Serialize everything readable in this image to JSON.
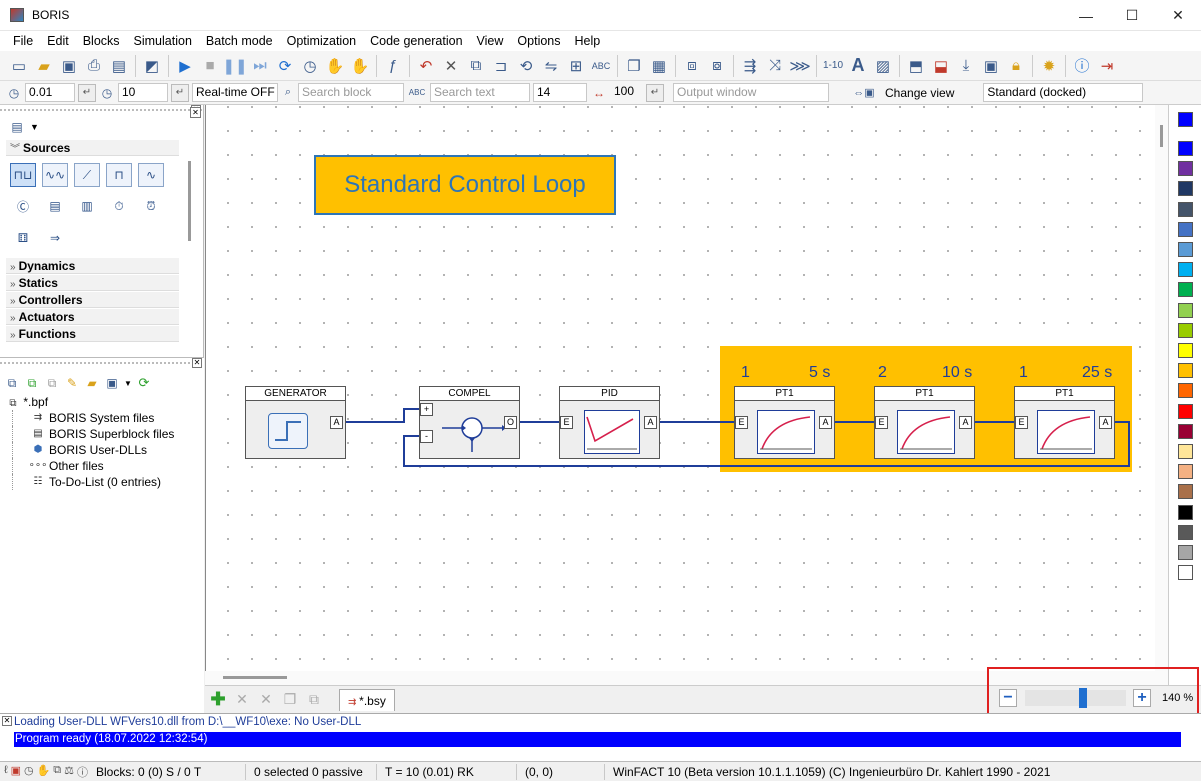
{
  "window": {
    "title": "BORIS",
    "buttons": {
      "minimize": "—",
      "maximize": "☐",
      "close": "✕"
    }
  },
  "menu": [
    "File",
    "Edit",
    "Blocks",
    "Simulation",
    "Batch mode",
    "Optimization",
    "Code generation",
    "View",
    "Options",
    "Help"
  ],
  "toolbar2": {
    "step_size": "0.01",
    "sim_time": "10",
    "realtime": "Real-time OFF",
    "search_block_placeholder": "Search block",
    "search_text_placeholder": "Search text",
    "font_size": "14",
    "width_value": "100",
    "output_window": "Output window",
    "change_view": "Change view",
    "view_mode": "Standard (docked)"
  },
  "library": {
    "categories": [
      {
        "label": "Sources",
        "expanded": true
      },
      {
        "label": "Dynamics"
      },
      {
        "label": "Statics"
      },
      {
        "label": "Controllers"
      },
      {
        "label": "Actuators"
      },
      {
        "label": "Functions"
      }
    ],
    "icons": [
      "square-wave-icon",
      "noise-icon",
      "ramp-icon",
      "pulse-icon",
      "signal-icon",
      "c-source-icon",
      "file-source-icon",
      "data-source-icon",
      "stopwatch-icon",
      "alarm-clock-icon",
      "dice-icon",
      "arrow-source-icon"
    ]
  },
  "files": {
    "root": "*.bpf",
    "items": [
      "BORIS System files",
      "BORIS Superblock files",
      "BORIS User-DLLs",
      "Other files",
      "To-Do-List (0 entries)"
    ]
  },
  "diagram": {
    "title": "Standard Control Loop",
    "blocks": [
      {
        "name": "GENERATOR",
        "ports_out": [
          "A"
        ]
      },
      {
        "name": "COMPEL",
        "ports_in": [
          "+",
          "-"
        ],
        "ports_out": [
          "O"
        ]
      },
      {
        "name": "PID",
        "ports_in": [
          "E"
        ],
        "ports_out": [
          "A"
        ]
      },
      {
        "name": "PT1",
        "ports_in": [
          "E"
        ],
        "ports_out": [
          "A"
        ],
        "gain": "1",
        "time": "5 s"
      },
      {
        "name": "PT1",
        "ports_in": [
          "E"
        ],
        "ports_out": [
          "A"
        ],
        "gain": "2",
        "time": "10 s"
      },
      {
        "name": "PT1",
        "ports_in": [
          "E"
        ],
        "ports_out": [
          "A"
        ],
        "gain": "1",
        "time": "25 s"
      }
    ]
  },
  "palette_colors": [
    "#0000ff",
    "#0000ff",
    "#7030a0",
    "#203864",
    "#44546a",
    "#4472c4",
    "#5b9bd5",
    "#00b0f0",
    "#00b050",
    "#92d050",
    "#99cc00",
    "#ffff00",
    "#ffc000",
    "#ff6600",
    "#ff0000",
    "#990033",
    "#ffe699",
    "#f4b183",
    "#a9704a",
    "#000000",
    "#595959",
    "#a6a6a6",
    "#ffffff"
  ],
  "tabs": {
    "document": "*.bsy"
  },
  "zoom": {
    "level": "140 %",
    "fraction": 0.58
  },
  "log": {
    "line1": "Loading User-DLL WFVers10.dll from D:\\__WF10\\exe: No User-DLL",
    "line2": "Program ready    (18.07.2022 12:32:54)"
  },
  "status": {
    "blocks": "Blocks: 0 (0) S / 0 T",
    "selection": "0 selected  0 passive",
    "time": "T = 10  (0.01)  RK",
    "coords": "(0, 0)",
    "version": "WinFACT 10 (Beta version 10.1.1.1059)  (C) Ingenieurbüro Dr. Kahlert 1990 - 2021"
  }
}
